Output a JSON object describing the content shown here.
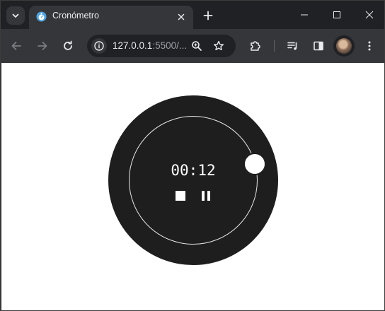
{
  "browser": {
    "tab": {
      "title": "Cronómetro",
      "favicon": "stopwatch-favicon-icon"
    },
    "omnibox": {
      "host": "127.0.0.1",
      "rest": ":5500/..."
    },
    "colors": {
      "frame": "#202124",
      "toolbar": "#35363a",
      "text": "#e8eaed"
    }
  },
  "stopwatch": {
    "time": "00:12",
    "controls": [
      "stop",
      "pause"
    ],
    "colors": {
      "dial": "#1e1e1e",
      "ring": "#e8e8e8",
      "knob": "#ffffff",
      "page_background": "#ffffff"
    }
  }
}
